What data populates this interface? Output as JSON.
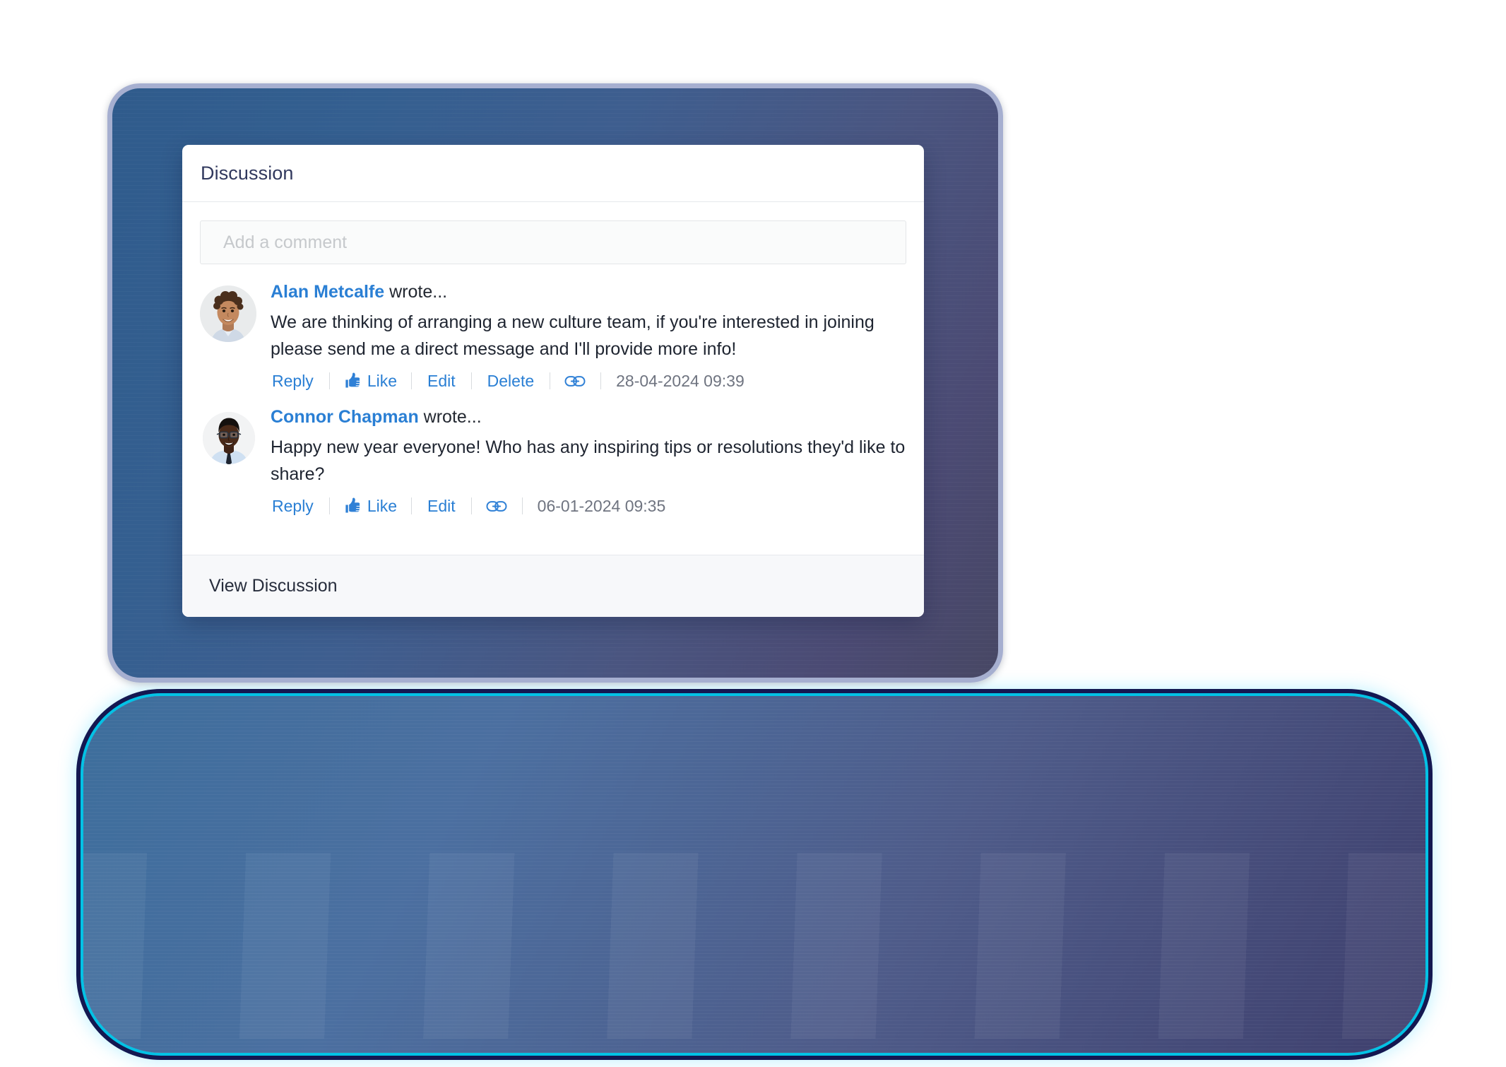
{
  "card": {
    "title": "Discussion",
    "footer_link": "View Discussion"
  },
  "composer": {
    "placeholder": "Add a comment",
    "value": ""
  },
  "comments": [
    {
      "author": "Alan Metcalfe",
      "wrote_suffix": " wrote...",
      "text": "We are thinking of arranging a new culture team, if you're interested in joining please send me a direct message and I'll provide more info!",
      "timestamp": "28-04-2024 09:39",
      "actions": {
        "reply": "Reply",
        "like": "Like",
        "edit": "Edit",
        "delete": "Delete"
      },
      "avatar_alt": "avatar-alan-metcalfe"
    },
    {
      "author": "Connor Chapman",
      "wrote_suffix": " wrote...",
      "text": "Happy new year everyone! Who has any inspiring tips or resolutions they'd like to share?",
      "timestamp": "06-01-2024 09:35",
      "actions": {
        "reply": "Reply",
        "like": "Like",
        "edit": "Edit"
      },
      "avatar_alt": "avatar-connor-chapman"
    }
  ],
  "icons": {
    "thumbs_up": "thumbs-up-icon",
    "link": "link-icon"
  },
  "colors": {
    "accent_link": "#2a7fd4",
    "title": "#31395e",
    "body_text": "#1e2430",
    "timestamp": "#6f7480",
    "placeholder": "#c6c9cc",
    "frame_border": "#a6afd0",
    "glow_cyan": "#00e0ff",
    "glow_navy": "#0a0c48",
    "footer_bg": "#f7f8fa"
  }
}
